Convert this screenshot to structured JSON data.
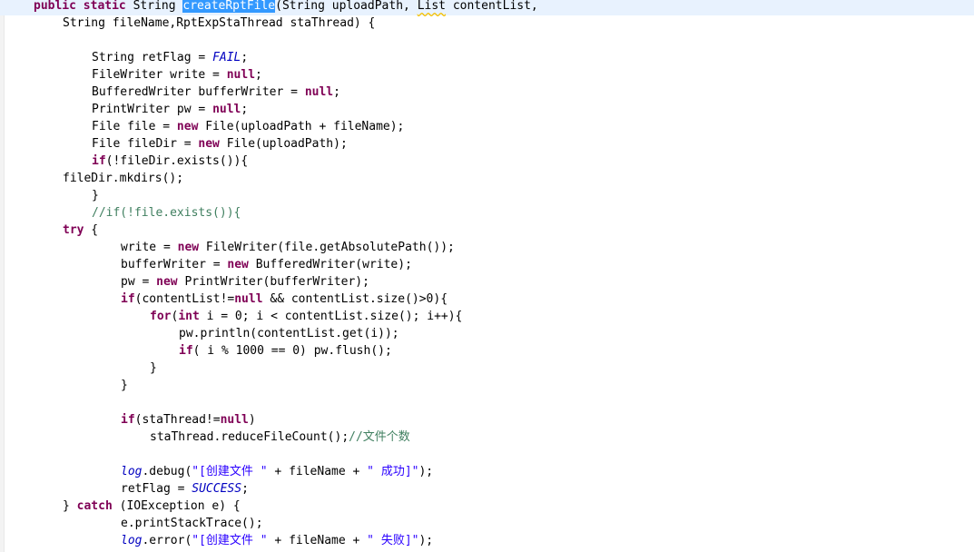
{
  "editor": {
    "language": "java",
    "colors": {
      "keyword": "#7f0055",
      "static_field": "#0000c0",
      "string": "#2a00ff",
      "comment": "#3f7f5f",
      "selection": "#3399ff",
      "current_line": "#e8f2fe",
      "warning_underline": "#f4c000"
    },
    "lines": [
      {
        "indent": 1,
        "current": true,
        "tokens": [
          {
            "t": "public",
            "s": "kw"
          },
          {
            "t": " "
          },
          {
            "t": "static",
            "s": "kw"
          },
          {
            "t": " String "
          },
          {
            "t": "createRptFile",
            "s": "sel"
          },
          {
            "t": "(String uploadPath, "
          },
          {
            "t": "List",
            "s": "warn"
          },
          {
            "t": " contentList,"
          }
        ]
      },
      {
        "indent": 3,
        "tokens": [
          {
            "t": "String fileName,RptExpStaThread staThread) {"
          }
        ]
      },
      {
        "indent": 0,
        "tokens": []
      },
      {
        "indent": 2,
        "tokens": [
          {
            "t": "String retFlag = "
          },
          {
            "t": "FAIL",
            "s": "field"
          },
          {
            "t": ";"
          }
        ]
      },
      {
        "indent": 2,
        "tokens": [
          {
            "t": "FileWriter write = "
          },
          {
            "t": "null",
            "s": "kw"
          },
          {
            "t": ";"
          }
        ]
      },
      {
        "indent": 2,
        "tokens": [
          {
            "t": "BufferedWriter bufferWriter = "
          },
          {
            "t": "null",
            "s": "kw"
          },
          {
            "t": ";"
          }
        ]
      },
      {
        "indent": 2,
        "tokens": [
          {
            "t": "PrintWriter pw = "
          },
          {
            "t": "null",
            "s": "kw"
          },
          {
            "t": ";"
          }
        ]
      },
      {
        "indent": 2,
        "tokens": [
          {
            "t": "File file = "
          },
          {
            "t": "new",
            "s": "kw"
          },
          {
            "t": " File(uploadPath + fileName);"
          }
        ]
      },
      {
        "indent": 2,
        "tokens": [
          {
            "t": "File fileDir = "
          },
          {
            "t": "new",
            "s": "kw"
          },
          {
            "t": " File(uploadPath);"
          }
        ]
      },
      {
        "indent": 2,
        "tokens": [
          {
            "t": "if",
            "s": "kw"
          },
          {
            "t": "(!fileDir.exists()){"
          }
        ]
      },
      {
        "indent": 3,
        "tokens": [
          {
            "t": "fileDir.mkdirs();"
          }
        ]
      },
      {
        "indent": 2,
        "tokens": [
          {
            "t": "}"
          }
        ]
      },
      {
        "indent": 2,
        "tokens": [
          {
            "t": "//if(!file.exists()){",
            "s": "comment"
          }
        ]
      },
      {
        "indent": 3,
        "tokens": [
          {
            "t": "try",
            "s": "kw"
          },
          {
            "t": " {"
          }
        ]
      },
      {
        "indent": 4,
        "tokens": [
          {
            "t": "write = "
          },
          {
            "t": "new",
            "s": "kw"
          },
          {
            "t": " FileWriter(file.getAbsolutePath());"
          }
        ]
      },
      {
        "indent": 4,
        "tokens": [
          {
            "t": "bufferWriter = "
          },
          {
            "t": "new",
            "s": "kw"
          },
          {
            "t": " BufferedWriter(write);"
          }
        ]
      },
      {
        "indent": 4,
        "tokens": [
          {
            "t": "pw = "
          },
          {
            "t": "new",
            "s": "kw"
          },
          {
            "t": " PrintWriter(bufferWriter);"
          }
        ]
      },
      {
        "indent": 4,
        "tokens": [
          {
            "t": "if",
            "s": "kw"
          },
          {
            "t": "(contentList!="
          },
          {
            "t": "null",
            "s": "kw"
          },
          {
            "t": " && contentList.size()>0){"
          }
        ]
      },
      {
        "indent": 5,
        "tokens": [
          {
            "t": "for",
            "s": "kw"
          },
          {
            "t": "("
          },
          {
            "t": "int",
            "s": "kw"
          },
          {
            "t": " i = 0; i < contentList.size(); i++){"
          }
        ]
      },
      {
        "indent": 6,
        "tokens": [
          {
            "t": "pw.println(contentList.get(i));"
          }
        ]
      },
      {
        "indent": 6,
        "tokens": [
          {
            "t": "if",
            "s": "kw"
          },
          {
            "t": "( i % 1000 == 0) pw.flush();"
          }
        ]
      },
      {
        "indent": 5,
        "tokens": [
          {
            "t": "}"
          }
        ]
      },
      {
        "indent": 4,
        "tokens": [
          {
            "t": "}"
          }
        ]
      },
      {
        "indent": 0,
        "tokens": []
      },
      {
        "indent": 4,
        "tokens": [
          {
            "t": "if",
            "s": "kw"
          },
          {
            "t": "(staThread!="
          },
          {
            "t": "null",
            "s": "kw"
          },
          {
            "t": ")"
          }
        ]
      },
      {
        "indent": 5,
        "tokens": [
          {
            "t": "staThread.reduceFileCount();"
          },
          {
            "t": "//文件个数",
            "s": "comment"
          }
        ]
      },
      {
        "indent": 0,
        "tokens": []
      },
      {
        "indent": 4,
        "tokens": [
          {
            "t": "log",
            "s": "field"
          },
          {
            "t": ".debug("
          },
          {
            "t": "\"[创建文件 \"",
            "s": "str"
          },
          {
            "t": " + fileName + "
          },
          {
            "t": "\" 成功]\"",
            "s": "str"
          },
          {
            "t": ");"
          }
        ]
      },
      {
        "indent": 4,
        "tokens": [
          {
            "t": "retFlag = "
          },
          {
            "t": "SUCCESS",
            "s": "field"
          },
          {
            "t": ";"
          }
        ]
      },
      {
        "indent": 3,
        "tokens": [
          {
            "t": "} "
          },
          {
            "t": "catch",
            "s": "kw"
          },
          {
            "t": " (IOException e) {"
          }
        ]
      },
      {
        "indent": 4,
        "tokens": [
          {
            "t": "e.printStackTrace();"
          }
        ]
      },
      {
        "indent": 4,
        "tokens": [
          {
            "t": "log",
            "s": "field"
          },
          {
            "t": ".error("
          },
          {
            "t": "\"[创建文件 \"",
            "s": "str"
          },
          {
            "t": " + fileName + "
          },
          {
            "t": "\" 失败]\"",
            "s": "str"
          },
          {
            "t": ");"
          }
        ]
      }
    ]
  }
}
